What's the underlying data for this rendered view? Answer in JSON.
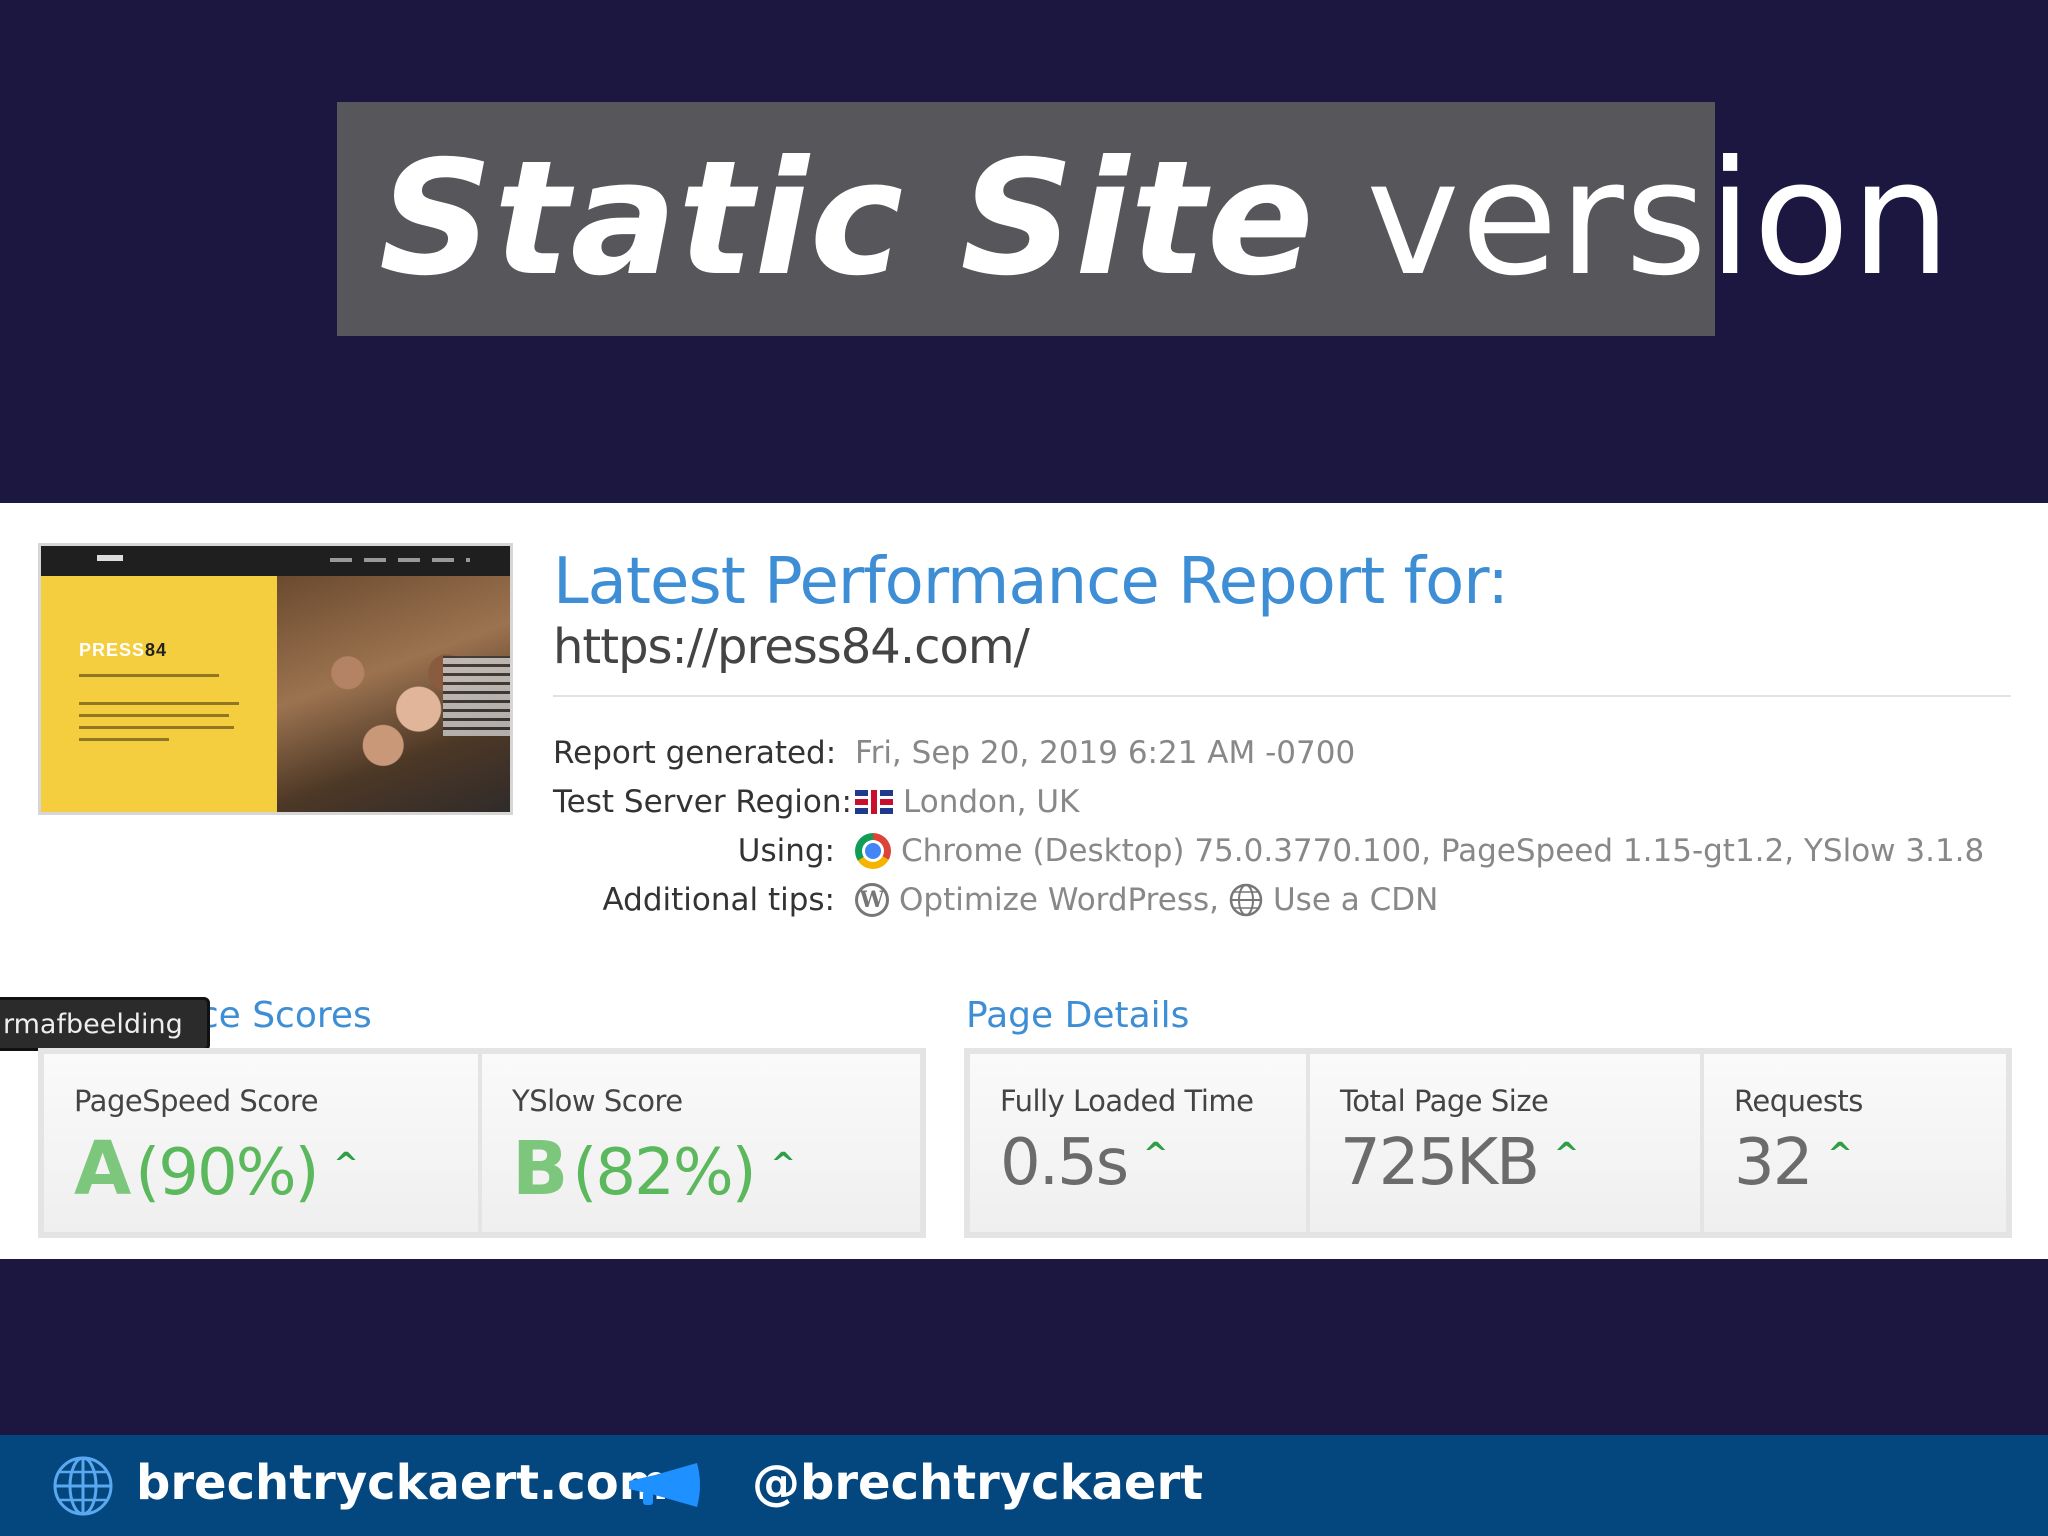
{
  "slide": {
    "title_bold": "Static Site",
    "title_rest": " version"
  },
  "thumbnail": {
    "brand_a": "PRESS",
    "brand_b": "84"
  },
  "report": {
    "heading": "Latest Performance Report for:",
    "url": "https://press84.com/",
    "meta": [
      {
        "label": "Report generated:",
        "value": "Fri, Sep 20, 2019 6:21 AM -0700"
      },
      {
        "label": "Test Server Region:",
        "value": "London, UK"
      },
      {
        "label": "Using:",
        "value": "Chrome (Desktop) 75.0.3770.100, PageSpeed 1.15-gt1.2, YSlow 3.1.8"
      },
      {
        "label": "Additional tips:",
        "value_a": "Optimize WordPress,",
        "value_b": "Use a CDN"
      }
    ]
  },
  "scores": {
    "section_title": "nce Scores",
    "tooltip": "rmafbeelding",
    "pagespeed": {
      "label": "PageSpeed Score",
      "grade": "A",
      "percent": "(90%)"
    },
    "yslow": {
      "label": "YSlow Score",
      "grade": "B",
      "percent": "(82%)"
    }
  },
  "details": {
    "section_title": "Page Details",
    "loaded": {
      "label": "Fully Loaded Time",
      "value": "0.5s"
    },
    "size": {
      "label": "Total Page Size",
      "value": "725KB"
    },
    "requests": {
      "label": "Requests",
      "value": "32"
    }
  },
  "footer": {
    "website": "brechtryckaert.com",
    "handle": "@brechtryckaert"
  },
  "colors": {
    "background": "#1c1740",
    "accent_blue": "#3e8ed6",
    "score_green": "#5cb85c",
    "footer_blue": "#04477f"
  }
}
